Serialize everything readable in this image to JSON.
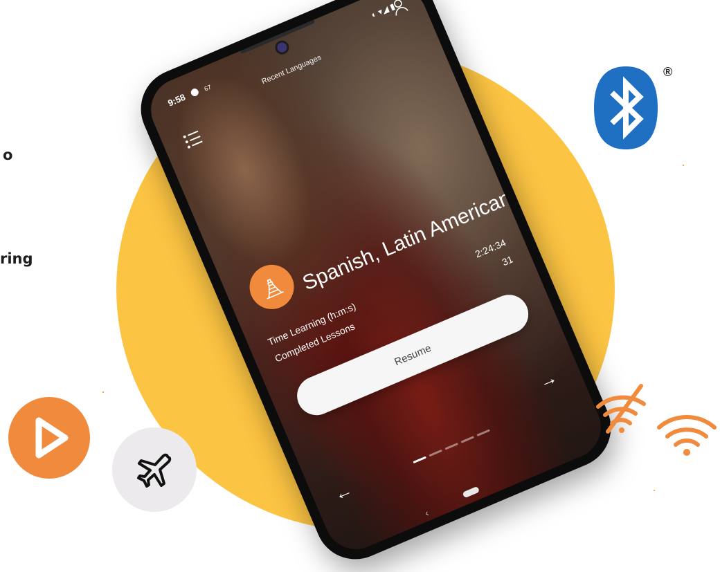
{
  "side_text": [
    "o",
    "ring"
  ],
  "phone": {
    "status_bar": {
      "time": "9:58",
      "extra": "67",
      "right_icons": "◐ ▾◢ ▮"
    },
    "top_title": "Recent Languages",
    "language": "Spanish, Latin American",
    "stats": [
      {
        "label": "Time Learning (h:m:s)",
        "value": "2:24:34"
      },
      {
        "label": "Completed Lessons",
        "value": "31"
      }
    ],
    "resume_label": "Resume",
    "arrow_right": "→",
    "arrow_left": "←",
    "back_symbol": "‹",
    "page_dots": 5,
    "active_dot": 0
  },
  "registered_mark": "®",
  "colors": {
    "yellow": "#fcc443",
    "orange": "#f08a3c",
    "bluetooth_blue": "#1f6fc2",
    "wifi_orange": "#f08a3c"
  },
  "icons": [
    "menu-icon",
    "profile-icon",
    "pyramid-icon",
    "bluetooth-icon",
    "play-icon",
    "airplane-icon",
    "wifi-off-icon",
    "wifi-icon"
  ]
}
